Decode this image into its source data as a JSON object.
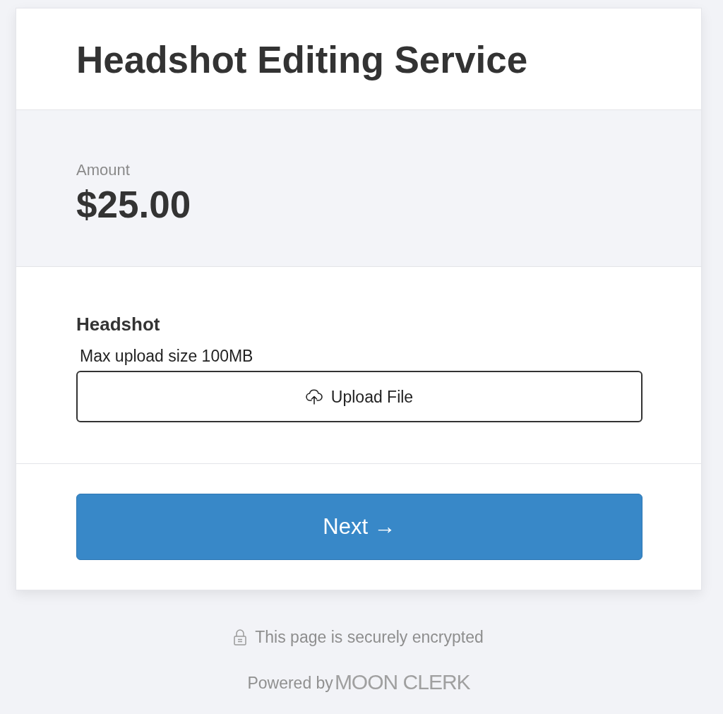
{
  "header": {
    "title": "Headshot Editing Service"
  },
  "amount": {
    "label": "Amount",
    "value": "$25.00"
  },
  "fields": [
    {
      "kind": "file",
      "label": "Headshot",
      "hint": "Max upload size 100MB",
      "button": "Upload File"
    }
  ],
  "next_button": {
    "label": "Next →"
  },
  "footer": {
    "security_note": "This page is securely encrypted",
    "powered_by": "Powered by",
    "brand": "MOON CLERK"
  }
}
